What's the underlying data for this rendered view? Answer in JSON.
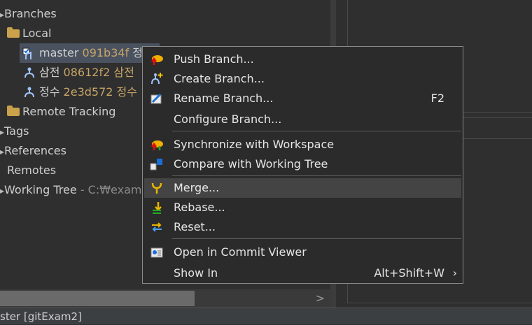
{
  "tree": {
    "branches": "Branches",
    "local": "Local",
    "master_name": "master",
    "master_hash": "091b34f",
    "master_trail": "정",
    "b1_name": "삼전",
    "b1_hash": "08612f2",
    "b1_trail": "삼전",
    "b2_name": "정수",
    "b2_hash": "2e3d572",
    "b2_trail": "정수",
    "remote_tracking": "Remote Tracking",
    "tags": "Tags",
    "references": "References",
    "remotes": "Remotes",
    "working_tree": "Working Tree",
    "working_tree_path": "- C:₩exam"
  },
  "status": {
    "text": "ster [gitExam2]"
  },
  "menu": {
    "push": "Push Branch...",
    "create": "Create Branch...",
    "rename": "Rename Branch...",
    "rename_accel": "F2",
    "configure": "Configure Branch...",
    "sync": "Synchronize with Workspace",
    "compare": "Compare with Working Tree",
    "merge": "Merge...",
    "rebase": "Rebase...",
    "reset": "Reset...",
    "open_commit": "Open in Commit Viewer",
    "show_in": "Show In",
    "show_in_accel": "Alt+Shift+W",
    "show_in_chevron": "›"
  },
  "icons": [
    "branch-icon",
    "folder-icon",
    "push-icon",
    "create-branch-icon",
    "rename-icon",
    "sync-icon",
    "compare-icon",
    "merge-icon",
    "rebase-icon",
    "reset-icon",
    "commit-viewer-icon"
  ],
  "colors": {
    "background": "#2f2f2f",
    "selection": "#4a5260",
    "hash": "#c8a567",
    "menu_bg": "#2b2b2b",
    "menu_hover": "#444444"
  }
}
